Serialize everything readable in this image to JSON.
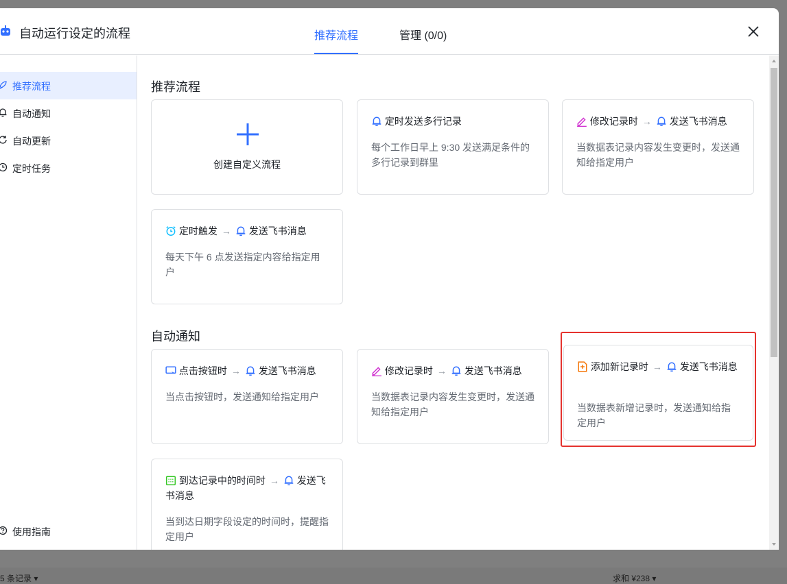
{
  "header": {
    "title": "自动运行设定的流程",
    "tabs": [
      {
        "label": "推荐流程",
        "active": true
      },
      {
        "label": "管理 (0/0)",
        "active": false
      }
    ]
  },
  "sidebar": {
    "items": [
      {
        "label": "推荐流程",
        "icon": "rocket-icon",
        "active": true
      },
      {
        "label": "自动通知",
        "icon": "bell-icon",
        "active": false
      },
      {
        "label": "自动更新",
        "icon": "refresh-icon",
        "active": false
      },
      {
        "label": "定时任务",
        "icon": "clock-icon",
        "active": false
      }
    ],
    "guide": {
      "label": "使用指南",
      "icon": "question-icon"
    }
  },
  "sections": {
    "recommended": {
      "title": "推荐流程",
      "create_label": "创建自定义流程",
      "cards": [
        {
          "trigger": "定时发送多行记录",
          "action": "",
          "desc": "每个工作日早上 9:30 发送满足条件的多行记录到群里"
        },
        {
          "trigger": "修改记录时",
          "action": "发送飞书消息",
          "desc": "当数据表记录内容发生变更时，发送通知给指定用户"
        },
        {
          "trigger": "定时触发",
          "action": "发送飞书消息",
          "desc": "每天下午 6 点发送指定内容给指定用户"
        }
      ]
    },
    "notify": {
      "title": "自动通知",
      "cards": [
        {
          "trigger": "点击按钮时",
          "action": "发送飞书消息",
          "desc": "当点击按钮时，发送通知给指定用户"
        },
        {
          "trigger": "修改记录时",
          "action": "发送飞书消息",
          "desc": "当数据表记录内容发生变更时，发送通知给指定用户"
        },
        {
          "trigger": "添加新记录时",
          "action": "发送飞书消息",
          "desc": "当数据表新增记录时，发送通知给指定用户"
        },
        {
          "trigger": "到达记录中的时间时",
          "action": "发送飞书消息",
          "desc": "当到达日期字段设定的时间时，提醒指定用户"
        }
      ]
    }
  },
  "arrow_glyph": "→",
  "statusbar": {
    "left": "5 条记录 ▾",
    "right": "求和 ¥238 ▾"
  },
  "colors": {
    "accent": "#3370ff",
    "highlight": "#e5322d",
    "pink": "#d136d1",
    "orange": "#f5780a",
    "cyan": "#14c0ff",
    "green": "#34c724"
  }
}
